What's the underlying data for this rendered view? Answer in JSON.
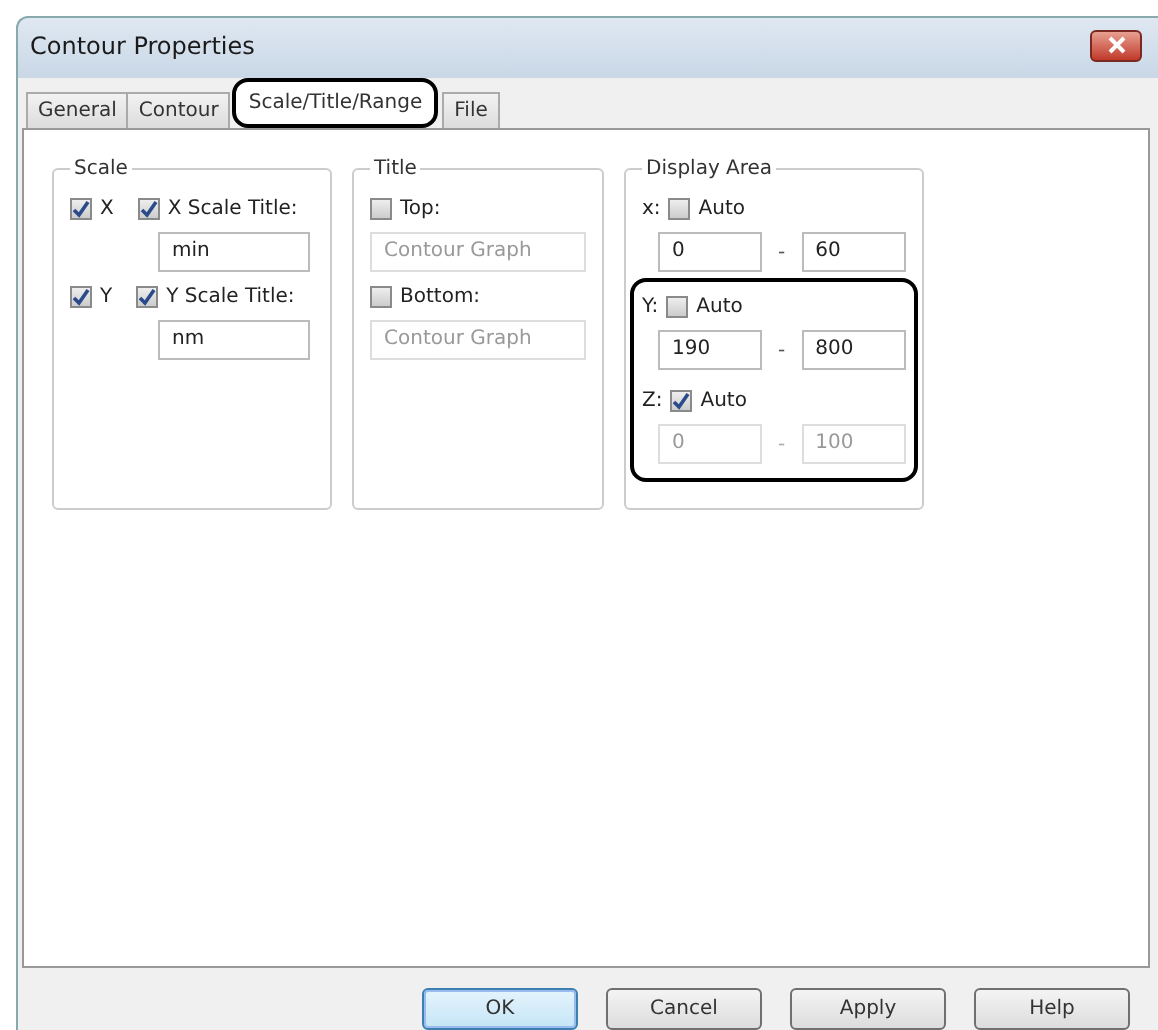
{
  "window": {
    "title": "Contour Properties"
  },
  "tabs": [
    {
      "label": "General",
      "selected": false
    },
    {
      "label": "Contour",
      "selected": false
    },
    {
      "label": "Scale/Title/Range",
      "selected": true
    },
    {
      "label": "File",
      "selected": false
    }
  ],
  "scale": {
    "title": "Scale",
    "axes": [
      {
        "label": "X",
        "checked": true,
        "title_label": "X Scale Title:",
        "title_checked": true,
        "value": "min",
        "disabled": false
      },
      {
        "label": "Y",
        "checked": true,
        "title_label": "Y Scale Title:",
        "title_checked": true,
        "value": "nm",
        "disabled": false
      }
    ]
  },
  "title_group": {
    "title": "Title",
    "items": [
      {
        "label": "Top:",
        "checked": false,
        "value": "Contour Graph",
        "disabled": true
      },
      {
        "label": "Bottom:",
        "checked": false,
        "value": "Contour Graph",
        "disabled": true
      }
    ]
  },
  "display_area": {
    "title": "Display Area",
    "axes": [
      {
        "axis": "x:",
        "label": "Auto",
        "checked": false,
        "min": "0",
        "separator": "-",
        "max": "60",
        "disabled": false,
        "highlighted": false
      },
      {
        "axis": "Y:",
        "label": "Auto",
        "checked": false,
        "min": "190",
        "separator": "-",
        "max": "800",
        "disabled": false,
        "highlighted": true
      },
      {
        "axis": "Z:",
        "label": "Auto",
        "checked": true,
        "min": "0",
        "separator": "-",
        "max": "100",
        "disabled": true,
        "highlighted": true
      }
    ]
  },
  "buttons": [
    {
      "label": "OK",
      "default": true
    },
    {
      "label": "Cancel",
      "default": false
    },
    {
      "label": "Apply",
      "default": false
    },
    {
      "label": "Help",
      "default": false
    }
  ]
}
